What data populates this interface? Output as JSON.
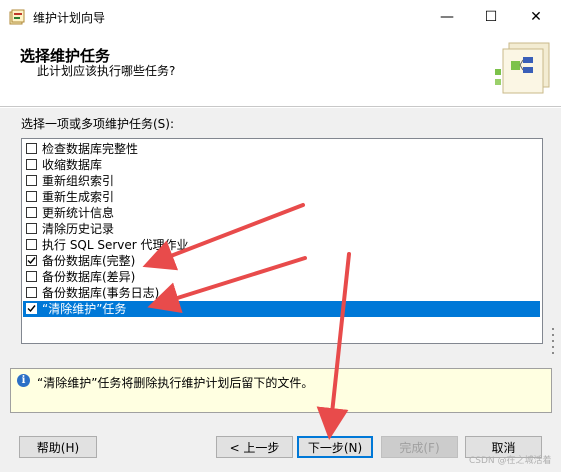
{
  "window": {
    "title": "维护计划向导",
    "minimize_symbol": "—",
    "maximize_symbol": "☐",
    "close_symbol": "✕"
  },
  "header": {
    "title": "选择维护任务",
    "subtitle": "此计划应该执行哪些任务?"
  },
  "list": {
    "label": "选择一项或多项维护任务(S):",
    "items": [
      {
        "label": "检查数据库完整性",
        "checked": false
      },
      {
        "label": "收缩数据库",
        "checked": false
      },
      {
        "label": "重新组织索引",
        "checked": false
      },
      {
        "label": "重新生成索引",
        "checked": false
      },
      {
        "label": "更新统计信息",
        "checked": false
      },
      {
        "label": "清除历史记录",
        "checked": false
      },
      {
        "label": "执行 SQL Server 代理作业",
        "checked": false
      },
      {
        "label": "备份数据库(完整)",
        "checked": true
      },
      {
        "label": "备份数据库(差异)",
        "checked": false
      },
      {
        "label": "备份数据库(事务日志)",
        "checked": false
      },
      {
        "label": "“清除维护”任务",
        "checked": true,
        "selected": true
      }
    ]
  },
  "info": {
    "icon": "info-icon",
    "text": "“清除维护”任务将删除执行维护计划后留下的文件。"
  },
  "buttons": {
    "help": "帮助(H)",
    "back": "< 上一步",
    "next": "下一步(N)",
    "finish": "完成(F)",
    "cancel": "取消"
  },
  "watermark": "CSDN @在之城活着",
  "colors": {
    "selection": "#0078d7",
    "annotation_arrow": "#e84b4b",
    "info_background": "#ffffe1"
  }
}
